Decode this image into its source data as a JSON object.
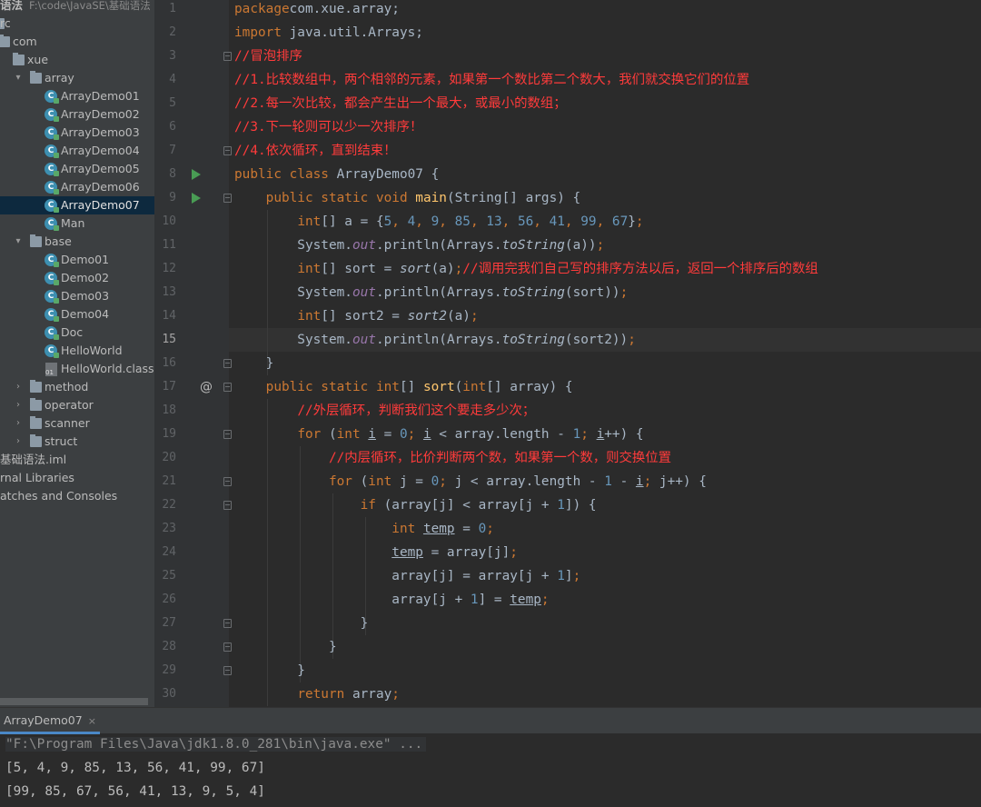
{
  "project_tree": {
    "header_title": "语法",
    "header_path": "F:\\code\\JavaSE\\基础语法",
    "items": [
      {
        "label": "rc",
        "arrow": "",
        "icon": "folder"
      },
      {
        "label": "com",
        "arrow": "▾",
        "icon": "folder"
      },
      {
        "label": "xue",
        "arrow": "▾",
        "icon": "folder"
      },
      {
        "label": "array",
        "arrow": "▾",
        "icon": "folder"
      },
      {
        "label": "ArrayDemo01",
        "arrow": "",
        "icon": "class"
      },
      {
        "label": "ArrayDemo02",
        "arrow": "",
        "icon": "class"
      },
      {
        "label": "ArrayDemo03",
        "arrow": "",
        "icon": "class"
      },
      {
        "label": "ArrayDemo04",
        "arrow": "",
        "icon": "class"
      },
      {
        "label": "ArrayDemo05",
        "arrow": "",
        "icon": "class"
      },
      {
        "label": "ArrayDemo06",
        "arrow": "",
        "icon": "class"
      },
      {
        "label": "ArrayDemo07",
        "arrow": "",
        "icon": "class",
        "selected": true
      },
      {
        "label": "Man",
        "arrow": "",
        "icon": "class"
      },
      {
        "label": "base",
        "arrow": "▾",
        "icon": "folder"
      },
      {
        "label": "Demo01",
        "arrow": "",
        "icon": "class"
      },
      {
        "label": "Demo02",
        "arrow": "",
        "icon": "class"
      },
      {
        "label": "Demo03",
        "arrow": "",
        "icon": "class"
      },
      {
        "label": "Demo04",
        "arrow": "",
        "icon": "class"
      },
      {
        "label": "Doc",
        "arrow": "",
        "icon": "class"
      },
      {
        "label": "HelloWorld",
        "arrow": "",
        "icon": "class"
      },
      {
        "label": "HelloWorld.class",
        "arrow": "",
        "icon": "classfile"
      },
      {
        "label": "method",
        "arrow": "›",
        "icon": "folder"
      },
      {
        "label": "operator",
        "arrow": "›",
        "icon": "folder"
      },
      {
        "label": "scanner",
        "arrow": "›",
        "icon": "folder"
      },
      {
        "label": "struct",
        "arrow": "›",
        "icon": "folder"
      },
      {
        "label": "基础语法.iml",
        "arrow": "",
        "icon": "none"
      },
      {
        "label": "rnal Libraries",
        "arrow": "",
        "icon": "none"
      },
      {
        "label": "atches and Consoles",
        "arrow": "",
        "icon": "none"
      }
    ]
  },
  "editor": {
    "current_line": 15,
    "lines": [
      [
        [
          "kw",
          "package"
        ],
        [
          "",
          "com.xue.array;"
        ]
      ],
      [
        [
          "kw",
          "import"
        ],
        [
          "",
          " java.util.Arrays;"
        ]
      ],
      [
        [
          "cm",
          "//冒泡排序"
        ]
      ],
      [
        [
          "cm",
          "//1.比较数组中，两个相邻的元素，如果第一个数比第二个数大，我们就交换它们的位置"
        ]
      ],
      [
        [
          "cm",
          "//2.每一次比较，都会产生出一个最大，或最小的数组；"
        ]
      ],
      [
        [
          "cm",
          "//3.下一轮则可以少一次排序！"
        ]
      ],
      [
        [
          "cm",
          "//4.依次循环，直到结束！"
        ]
      ],
      [
        [
          "kw",
          "public class "
        ],
        [
          "",
          "ArrayDemo07 {"
        ]
      ],
      [
        [
          "",
          "    "
        ],
        [
          "kw",
          "public static void "
        ],
        [
          "fn",
          "main"
        ],
        [
          "",
          "(String[] args) {"
        ]
      ],
      [
        [
          "",
          "        "
        ],
        [
          "kw",
          "int"
        ],
        [
          "",
          "[] a = {"
        ],
        [
          "num",
          "5"
        ],
        [
          "kw",
          ", "
        ],
        [
          "num",
          "4"
        ],
        [
          "kw",
          ", "
        ],
        [
          "num",
          "9"
        ],
        [
          "kw",
          ", "
        ],
        [
          "num",
          "85"
        ],
        [
          "kw",
          ", "
        ],
        [
          "num",
          "13"
        ],
        [
          "kw",
          ", "
        ],
        [
          "num",
          "56"
        ],
        [
          "kw",
          ", "
        ],
        [
          "num",
          "41"
        ],
        [
          "kw",
          ", "
        ],
        [
          "num",
          "99"
        ],
        [
          "kw",
          ", "
        ],
        [
          "num",
          "67"
        ],
        [
          "",
          "}"
        ],
        [
          "kw",
          ";"
        ]
      ],
      [
        [
          "",
          "        System."
        ],
        [
          "fld",
          "out"
        ],
        [
          "",
          ".println(Arrays."
        ],
        [
          "it",
          "toString"
        ],
        [
          "",
          "(a))"
        ],
        [
          "kw",
          ";"
        ]
      ],
      [
        [
          "",
          "        "
        ],
        [
          "kw",
          "int"
        ],
        [
          "",
          "[] sort = "
        ],
        [
          "it",
          "sort"
        ],
        [
          "",
          "(a)"
        ],
        [
          "kw",
          ";"
        ],
        [
          "cm",
          "//调用完我们自己写的排序方法以后，返回一个排序后的数组"
        ]
      ],
      [
        [
          "",
          "        System."
        ],
        [
          "fld",
          "out"
        ],
        [
          "",
          ".println(Arrays."
        ],
        [
          "it",
          "toString"
        ],
        [
          "",
          "(sort))"
        ],
        [
          "kw",
          ";"
        ]
      ],
      [
        [
          "",
          "        "
        ],
        [
          "kw",
          "int"
        ],
        [
          "",
          "[] sort2 = "
        ],
        [
          "it",
          "sort2"
        ],
        [
          "",
          "(a)"
        ],
        [
          "kw",
          ";"
        ]
      ],
      [
        [
          "",
          "        System."
        ],
        [
          "fld",
          "out"
        ],
        [
          "",
          ".println(Arrays."
        ],
        [
          "it",
          "toString"
        ],
        [
          "",
          "(sort2))"
        ],
        [
          "kw",
          ";"
        ]
      ],
      [
        [
          "",
          "    }"
        ]
      ],
      [
        [
          "",
          "    "
        ],
        [
          "kw",
          "public static int"
        ],
        [
          "",
          "[] "
        ],
        [
          "fn",
          "sort"
        ],
        [
          "",
          "("
        ],
        [
          "kw",
          "int"
        ],
        [
          "",
          "[] array) {"
        ]
      ],
      [
        [
          "",
          "        "
        ],
        [
          "cm",
          "//外层循环，判断我们这个要走多少次；"
        ]
      ],
      [
        [
          "",
          "        "
        ],
        [
          "kw",
          "for "
        ],
        [
          "",
          "("
        ],
        [
          "kw",
          "int "
        ],
        [
          "ul",
          "i"
        ],
        [
          "",
          " = "
        ],
        [
          "num",
          "0"
        ],
        [
          "kw",
          "; "
        ],
        [
          "ul",
          "i"
        ],
        [
          "",
          " < array.length - "
        ],
        [
          "num",
          "1"
        ],
        [
          "kw",
          "; "
        ],
        [
          "ul",
          "i"
        ],
        [
          "",
          "++) {"
        ]
      ],
      [
        [
          "",
          "            "
        ],
        [
          "cm",
          "//内层循环，比价判断两个数，如果第一个数，则交换位置"
        ]
      ],
      [
        [
          "",
          "            "
        ],
        [
          "kw",
          "for "
        ],
        [
          "",
          "("
        ],
        [
          "kw",
          "int "
        ],
        [
          "",
          "j = "
        ],
        [
          "num",
          "0"
        ],
        [
          "kw",
          "; "
        ],
        [
          "",
          "j < array.length - "
        ],
        [
          "num",
          "1"
        ],
        [
          "",
          " - "
        ],
        [
          "ul",
          "i"
        ],
        [
          "kw",
          "; "
        ],
        [
          "",
          "j++) {"
        ]
      ],
      [
        [
          "",
          "                "
        ],
        [
          "kw",
          "if "
        ],
        [
          "",
          "(array[j] < array[j + "
        ],
        [
          "num",
          "1"
        ],
        [
          "",
          "]) {"
        ]
      ],
      [
        [
          "",
          "                    "
        ],
        [
          "kw",
          "int "
        ],
        [
          "ul",
          "temp"
        ],
        [
          "",
          " = "
        ],
        [
          "num",
          "0"
        ],
        [
          "kw",
          ";"
        ]
      ],
      [
        [
          "",
          "                    "
        ],
        [
          "ul",
          "temp"
        ],
        [
          "",
          " = array[j]"
        ],
        [
          "kw",
          ";"
        ]
      ],
      [
        [
          "",
          "                    array[j] = array[j + "
        ],
        [
          "num",
          "1"
        ],
        [
          "",
          "]"
        ],
        [
          "kw",
          ";"
        ]
      ],
      [
        [
          "",
          "                    array[j + "
        ],
        [
          "num",
          "1"
        ],
        [
          "",
          "] = "
        ],
        [
          "ul",
          "temp"
        ],
        [
          "kw",
          ";"
        ]
      ],
      [
        [
          "",
          "                }"
        ]
      ],
      [
        [
          "",
          "            }"
        ]
      ],
      [
        [
          "",
          "        }"
        ]
      ],
      [
        [
          "",
          "        "
        ],
        [
          "kw",
          "return "
        ],
        [
          "",
          "array"
        ],
        [
          "kw",
          ";"
        ]
      ]
    ]
  },
  "run_panel": {
    "tab_label": "ArrayDemo07",
    "close_glyph": "×",
    "command": "\"F:\\Program Files\\Java\\jdk1.8.0_281\\bin\\java.exe\" ...",
    "output_1": "[5, 4, 9, 85, 13, 56, 41, 99, 67]",
    "output_2": "[99, 85, 67, 56, 41, 13, 9, 5, 4]"
  },
  "colors": {
    "keyword": "#cc7832",
    "comment": "#ff3b3b",
    "number": "#6897bb",
    "field": "#9876aa",
    "function": "#ffc66d",
    "text": "#a9b7c6",
    "selection": "#0d293e"
  }
}
